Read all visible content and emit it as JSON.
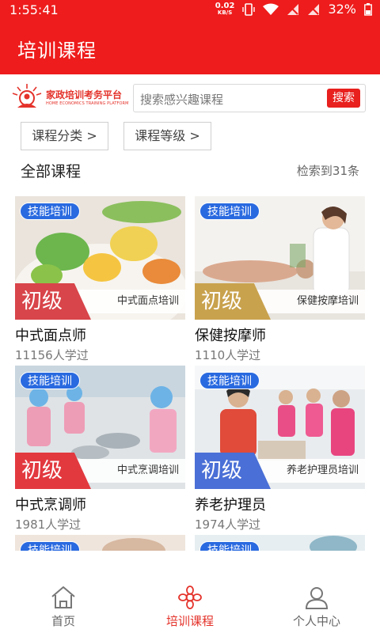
{
  "status_bar": {
    "time": "1:55:41",
    "net_speed": "0.02",
    "net_unit": "KB/S",
    "battery": "32%"
  },
  "app_bar": {
    "title": "培训课程"
  },
  "logo": {
    "name_cn": "家政培训考务平台",
    "name_en": "HOME ECONOMICS TRAINING PLATFORM"
  },
  "search": {
    "placeholder": "搜索感兴趣课程",
    "button": "搜索"
  },
  "filters": {
    "category": "课程分类 >",
    "level": "课程等级 >"
  },
  "section": {
    "title": "全部课程",
    "count": "检索到31条"
  },
  "courses": [
    {
      "tag": "技能培训",
      "level": "初级",
      "strip": "中式面点培训",
      "name": "中式面点师",
      "learners": "11156人学过",
      "band_color": "#d8454a"
    },
    {
      "tag": "技能培训",
      "level": "初级",
      "strip": "保健按摩培训",
      "name": "保健按摩师",
      "learners": "1110人学过",
      "band_color": "#c9a24e"
    },
    {
      "tag": "技能培训",
      "level": "初级",
      "strip": "中式烹调培训",
      "name": "中式烹调师",
      "learners": "1981人学过",
      "band_color": "#e2393f"
    },
    {
      "tag": "技能培训",
      "level": "初级",
      "strip": "养老护理员培训",
      "name": "养老护理员",
      "learners": "1974人学过",
      "band_color": "#4a6fd6"
    },
    {
      "tag": "技能培训"
    },
    {
      "tag": "技能培训"
    }
  ],
  "bottom_nav": [
    {
      "label": "首页",
      "icon": "home-icon",
      "active": false
    },
    {
      "label": "培训课程",
      "icon": "flower-icon",
      "active": true
    },
    {
      "label": "个人中心",
      "icon": "user-icon",
      "active": false
    }
  ],
  "colors": {
    "brand_red": "#ee1c1c",
    "tag_blue": "#2a6ae0",
    "active_red": "#e4322a"
  }
}
